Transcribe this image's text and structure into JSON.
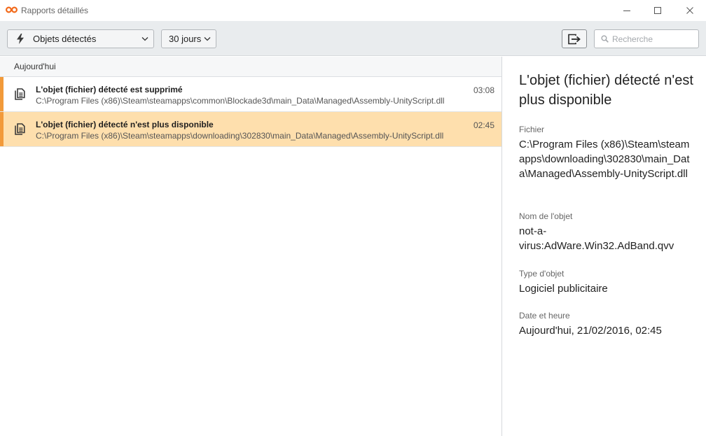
{
  "window": {
    "title": "Rapports détaillés",
    "accent_color": "#f29a3a",
    "logo_color": "#f26a1b"
  },
  "toolbar": {
    "filter_label": "Objets détectés",
    "period_label": "30 jours",
    "search_placeholder": "Recherche",
    "search_value": ""
  },
  "list": {
    "group_header": "Aujourd'hui",
    "rows": [
      {
        "title": "L'objet (fichier) détecté est supprimé",
        "path": "C:\\Program Files (x86)\\Steam\\steamapps\\common\\Blockade3d\\main_Data\\Managed\\Assembly-UnityScript.dll",
        "time": "03:08",
        "selected": false
      },
      {
        "title": "L'objet (fichier) détecté n'est plus disponible",
        "path": "C:\\Program Files (x86)\\Steam\\steamapps\\downloading\\302830\\main_Data\\Managed\\Assembly-UnityScript.dll",
        "time": "02:45",
        "selected": true
      }
    ]
  },
  "detail": {
    "title": "L'objet (fichier) détecté n'est plus disponible",
    "file_label": "Fichier",
    "file_value": "C:\\Program Files (x86)\\Steam\\steamapps\\downloading\\302830\\main_Data\\Managed\\Assembly-UnityScript.dll",
    "object_name_label": "Nom de l'objet",
    "object_name_value": "not-a-virus:AdWare.Win32.AdBand.qvv",
    "object_type_label": "Type d'objet",
    "object_type_value": "Logiciel publicitaire",
    "datetime_label": "Date et heure",
    "datetime_value": "Aujourd'hui, 21/02/2016, 02:45"
  }
}
